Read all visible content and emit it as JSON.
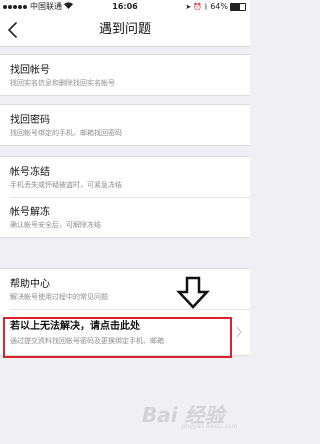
{
  "status_bar": {
    "carrier": "中国联通",
    "time": "16:06",
    "battery": "64%",
    "battery_level": 0.64
  },
  "nav": {
    "title": "遇到问题"
  },
  "groups": [
    {
      "items": [
        {
          "title": "找回帐号",
          "subtitle": "找回实名信息和删除找回实名帐号"
        }
      ]
    },
    {
      "items": [
        {
          "title": "找回密码",
          "subtitle": "找回帐号绑定的手机、邮箱找回密码"
        }
      ]
    },
    {
      "items": [
        {
          "title": "帐号冻结",
          "subtitle": "手机丢失或怀疑被盗时，可紧急冻结"
        },
        {
          "title": "帐号解冻",
          "subtitle": "确认帐号安全后，可解除冻结"
        }
      ]
    },
    {
      "items": [
        {
          "title": "帮助中心",
          "subtitle": "解决帐号使用过程中的常见问题"
        },
        {
          "title": "若以上无法解决，请点击此处",
          "subtitle": "通过提交资料找回帐号密码及更换绑定手机、邮箱"
        }
      ]
    }
  ],
  "annotation": {
    "highlight_color": "#d8232a"
  },
  "watermark": {
    "text": "Bai 经验",
    "sub": "jingyan.baidu.com"
  }
}
